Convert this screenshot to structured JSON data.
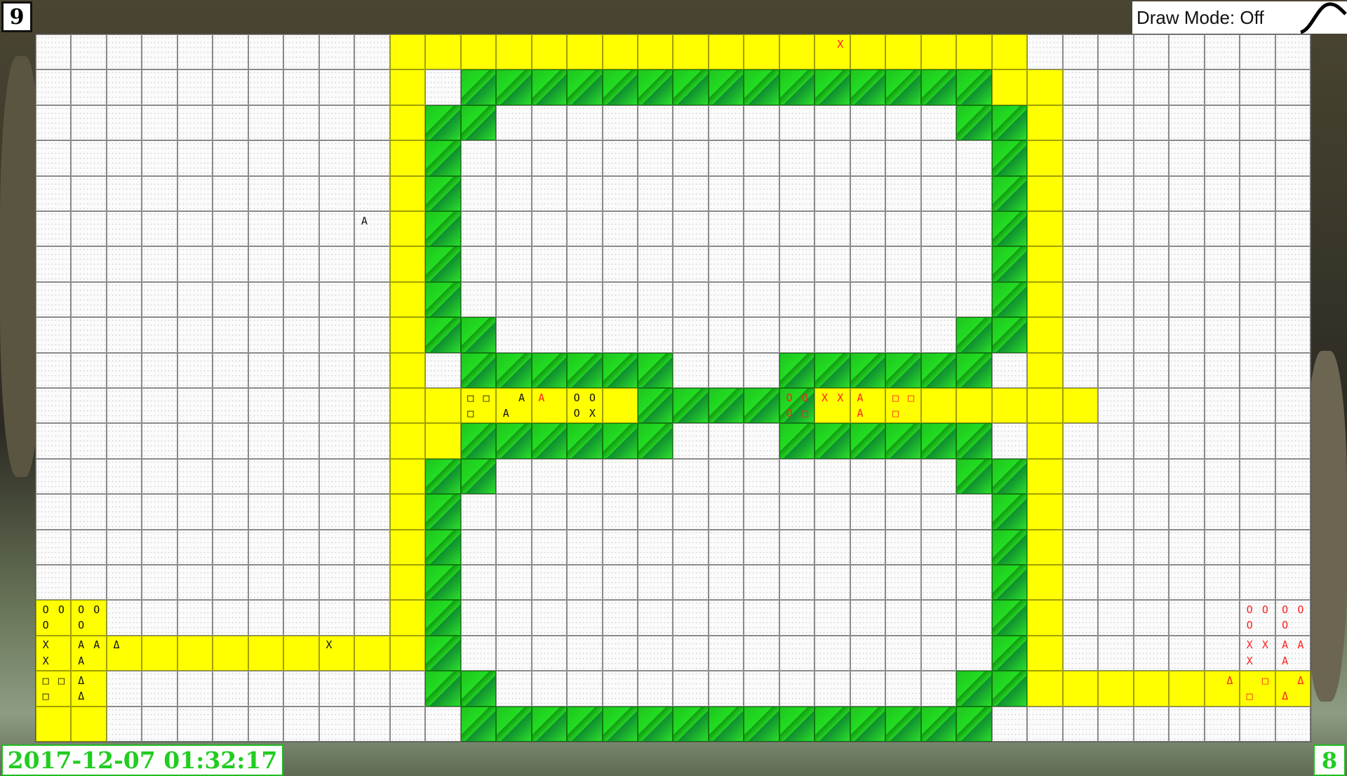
{
  "hud": {
    "level_number": "9",
    "draw_mode_label": "Draw Mode: Off",
    "timestamp": "2017-12-07 01:32:17",
    "counter": "8"
  },
  "colors": {
    "path_yellow": "#ffff00",
    "wall_green": "#22cc22",
    "player_red": "#ff2020",
    "player_black": "#111111",
    "hud_green": "#22cc22"
  },
  "board": {
    "cols": 36,
    "rows": 20,
    "tile_rows": [
      "..........YYYYYYYYYYYYYYYYYY..........",
      "..........Y.GGGGGGGGGGGGGGGYY.........",
      "..........YGG.............GGY.........",
      "..........YG...............GY.........",
      "..........YG...............GY.........",
      "..........YG...............GY.........",
      "..........YG...............GY.........",
      "..........YG...............GY.........",
      "..........YGG.............GGY.........",
      "..........Y.GGGGGG...GGGGGG.Y.........",
      "..........YYYYYYYGGGGGYYYYYYYY........",
      "..........YYGGGGGG...GGGGGG.Y.........",
      "..........YGG.............GGY.........",
      "..........YG...............GY.........",
      "..........YG...............GY.........",
      "..........YG...............GY.........",
      "YY........YG...............GY.......YY",
      "YYYYYYYYYYYG...............GY.......YY",
      "YY.........GG.............GGYYYYYYYYYY",
      "YY..........GGGGGGGGGGGGGGG.........YY"
    ],
    "marks": [
      {
        "r": 0,
        "c": 22,
        "color": "red",
        "cells": [
          "",
          "X",
          "",
          ""
        ]
      },
      {
        "r": 5,
        "c": 9,
        "color": "blk",
        "cells": [
          "A",
          "",
          "",
          ""
        ]
      },
      {
        "r": 10,
        "c": 12,
        "color": "blk",
        "cells": [
          "□",
          "□",
          "□",
          ""
        ]
      },
      {
        "r": 10,
        "c": 13,
        "color": "blk",
        "cells": [
          "",
          "A",
          "A",
          ""
        ]
      },
      {
        "r": 10,
        "c": 14,
        "color": "red",
        "cells": [
          "A",
          "",
          "",
          ""
        ]
      },
      {
        "r": 10,
        "c": 15,
        "color": "blk",
        "cells": [
          "O",
          "O",
          "O",
          "X"
        ]
      },
      {
        "r": 10,
        "c": 21,
        "color": "red",
        "cells": [
          "O",
          "O",
          "O",
          "□"
        ]
      },
      {
        "r": 10,
        "c": 22,
        "color": "red",
        "cells": [
          "X",
          "X",
          "",
          ""
        ]
      },
      {
        "r": 10,
        "c": 23,
        "color": "red",
        "cells": [
          "A",
          "",
          "A",
          ""
        ]
      },
      {
        "r": 10,
        "c": 24,
        "color": "red",
        "cells": [
          "□",
          "□",
          "□",
          ""
        ]
      },
      {
        "r": 16,
        "c": 0,
        "color": "blk",
        "cells": [
          "O",
          "O",
          "O",
          ""
        ]
      },
      {
        "r": 16,
        "c": 1,
        "color": "blk",
        "cells": [
          "O",
          "O",
          "O",
          ""
        ]
      },
      {
        "r": 17,
        "c": 0,
        "color": "blk",
        "cells": [
          "X",
          "",
          "X",
          ""
        ]
      },
      {
        "r": 17,
        "c": 1,
        "color": "blk",
        "cells": [
          "A",
          "A",
          "A",
          ""
        ]
      },
      {
        "r": 17,
        "c": 2,
        "color": "blk",
        "cells": [
          "Δ",
          "",
          "",
          ""
        ]
      },
      {
        "r": 17,
        "c": 8,
        "color": "blk",
        "cells": [
          "X",
          "",
          "",
          ""
        ]
      },
      {
        "r": 18,
        "c": 0,
        "color": "blk",
        "cells": [
          "□",
          "□",
          "□",
          ""
        ]
      },
      {
        "r": 18,
        "c": 1,
        "color": "blk",
        "cells": [
          "Δ",
          "",
          "Δ",
          ""
        ]
      },
      {
        "r": 16,
        "c": 34,
        "color": "red",
        "cells": [
          "O",
          "O",
          "O",
          ""
        ]
      },
      {
        "r": 16,
        "c": 35,
        "color": "red",
        "cells": [
          "O",
          "O",
          "O",
          ""
        ]
      },
      {
        "r": 17,
        "c": 34,
        "color": "red",
        "cells": [
          "X",
          "X",
          "X",
          ""
        ]
      },
      {
        "r": 17,
        "c": 35,
        "color": "red",
        "cells": [
          "A",
          "A",
          "A",
          ""
        ]
      },
      {
        "r": 18,
        "c": 33,
        "color": "red",
        "cells": [
          "",
          "Δ",
          "",
          ""
        ]
      },
      {
        "r": 18,
        "c": 34,
        "color": "red",
        "cells": [
          "",
          "□",
          "□",
          ""
        ]
      },
      {
        "r": 18,
        "c": 35,
        "color": "red",
        "cells": [
          "",
          "Δ",
          "Δ",
          ""
        ]
      }
    ]
  }
}
